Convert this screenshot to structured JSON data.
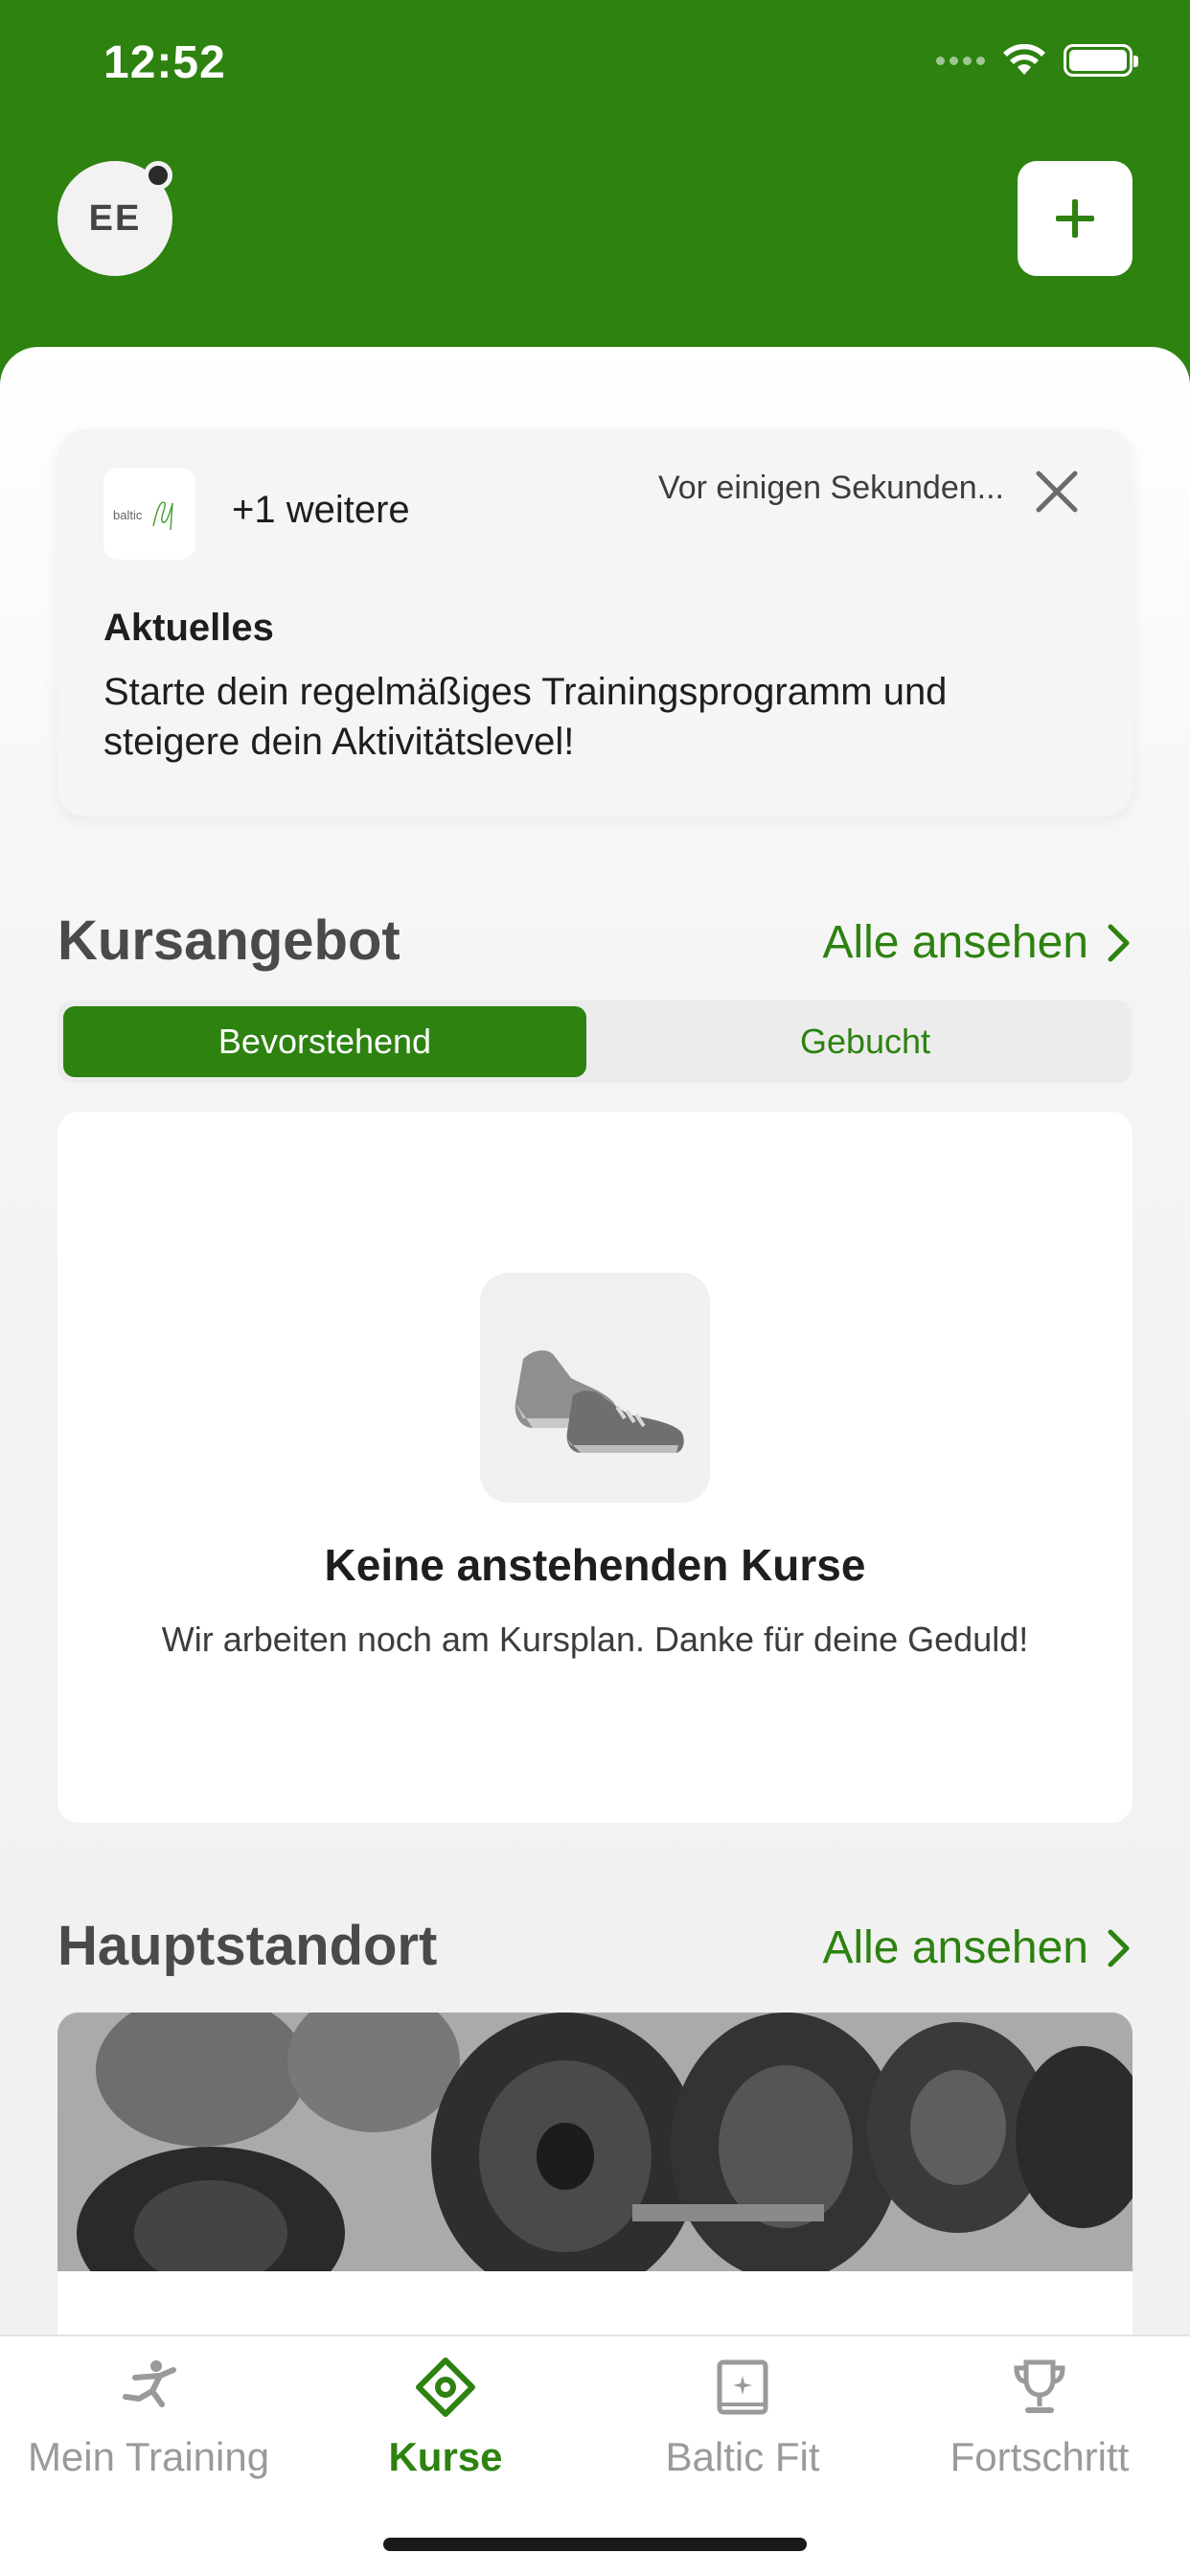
{
  "status_bar": {
    "time": "12:52"
  },
  "header": {
    "avatar_initials": "EE"
  },
  "news": {
    "logo_text": "baltic fit",
    "more_label": "+1 weitere",
    "time": "Vor einigen Sekunden...",
    "title": "Aktuelles",
    "body": "Starte dein regelmäßiges Trainingsprogramm und steigere dein Aktivitätslevel!"
  },
  "courses": {
    "title": "Kursangebot",
    "see_all": "Alle ansehen",
    "tabs": [
      {
        "label": "Bevorstehend",
        "active": true
      },
      {
        "label": "Gebucht",
        "active": false
      }
    ],
    "empty_title": "Keine anstehenden Kurse",
    "empty_subtitle": "Wir arbeiten noch am Kursplan. Danke für deine Geduld!"
  },
  "location": {
    "title": "Hauptstandort",
    "see_all": "Alle ansehen"
  },
  "tabbar": {
    "items": [
      {
        "label": "Mein Training",
        "icon": "running-figure-icon",
        "active": false
      },
      {
        "label": "Kurse",
        "icon": "target-diamond-icon",
        "active": true
      },
      {
        "label": "Baltic Fit",
        "icon": "gym-building-icon",
        "active": false
      },
      {
        "label": "Fortschritt",
        "icon": "trophy-icon",
        "active": false
      }
    ]
  },
  "colors": {
    "brand_green": "#2d8210",
    "inactive_gray": "#9a9a9a"
  }
}
